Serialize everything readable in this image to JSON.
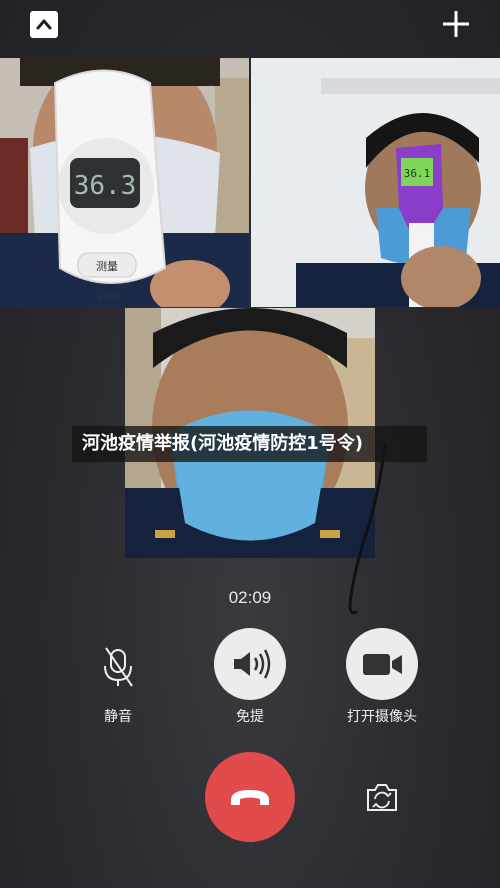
{
  "topbar": {
    "collapse_icon": "chevron-up-icon",
    "add_icon": "plus-icon"
  },
  "caption": {
    "text": "河池疫情举报(河池疫情防控1号令)"
  },
  "call": {
    "timer": "02:09"
  },
  "controls": [
    {
      "label": "静音",
      "icon": "microphone-icon"
    },
    {
      "label": "免提",
      "icon": "speaker-icon"
    },
    {
      "label": "打开摄像头",
      "icon": "video-camera-icon"
    }
  ],
  "thermometer_1": {
    "reading": "36.3",
    "button_text": "测量",
    "bottom_text": "开/关"
  },
  "thermometer_2": {
    "reading": "36.1"
  },
  "colors": {
    "hangup": "#e24b4b",
    "control_bg": "#ececec",
    "background": "#2a2a2e"
  }
}
